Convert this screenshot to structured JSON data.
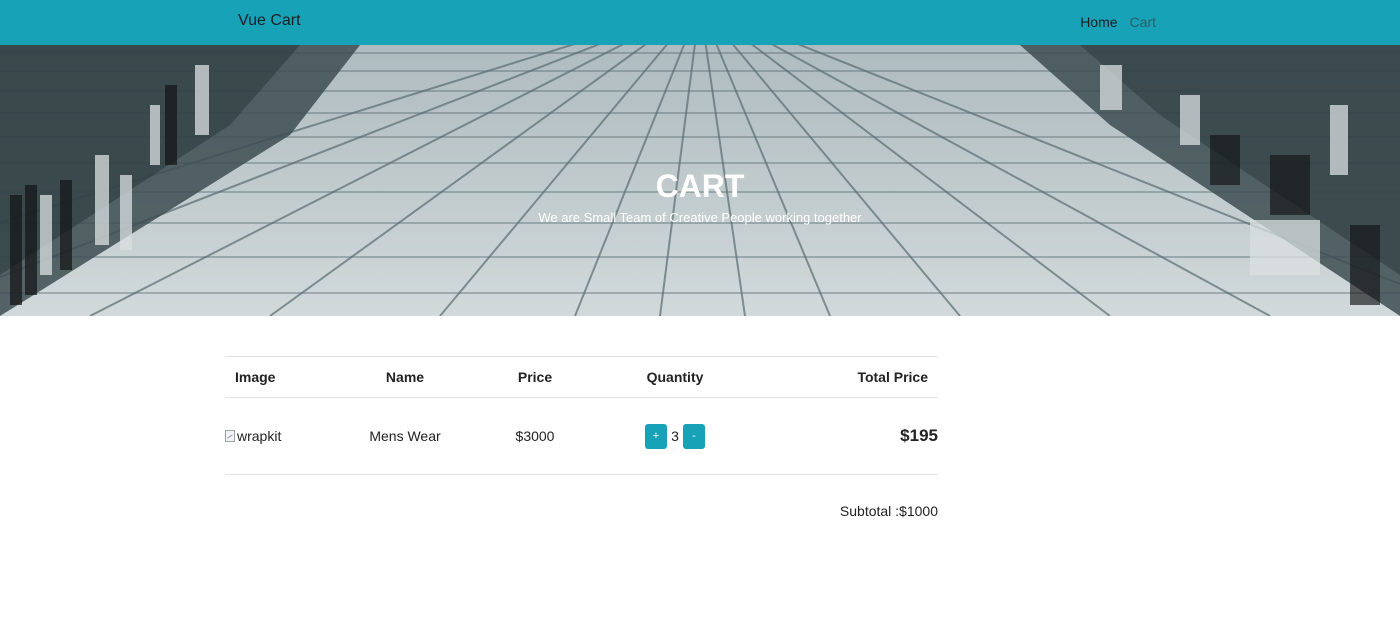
{
  "nav": {
    "brand": "Vue Cart",
    "links": [
      {
        "label": "Home",
        "active": true
      },
      {
        "label": "Cart",
        "active": false
      }
    ]
  },
  "hero": {
    "title": "CART",
    "subtitle": "We are Small Team of Creative People working together"
  },
  "cart": {
    "headers": [
      "Image",
      "Name",
      "Price",
      "Quantity",
      "Total Price"
    ],
    "items": [
      {
        "image_alt": "wrapkit",
        "name": "Mens Wear",
        "price": "$3000",
        "quantity": "3",
        "increment_label": "+",
        "decrement_label": "-",
        "total": "$195"
      }
    ],
    "subtotal": "Subtotal :$1000"
  },
  "colors": {
    "primary": "#17a2b8"
  }
}
